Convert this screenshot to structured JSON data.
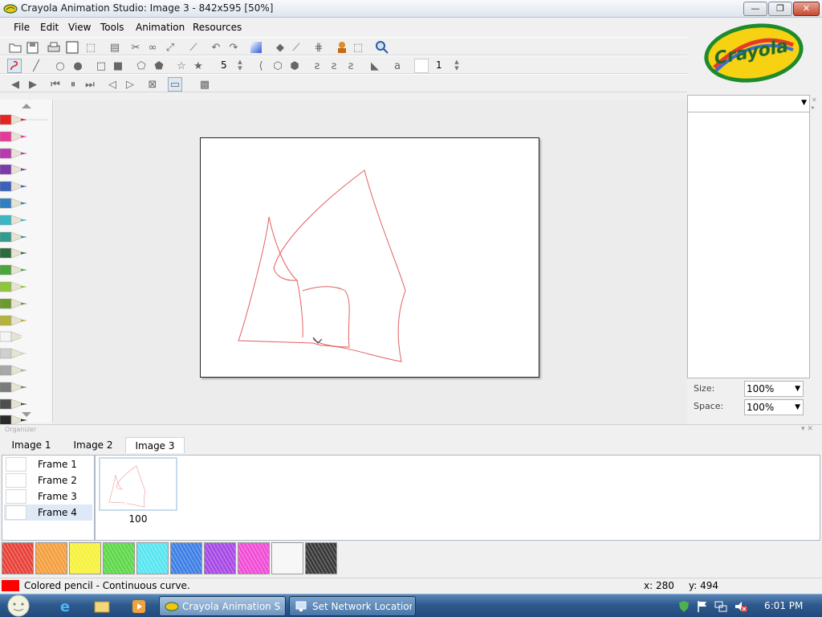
{
  "window": {
    "title": "Crayola Animation Studio: Image 3 - 842x595 [50%]",
    "minimize": "—",
    "maximize": "❐",
    "close": "✕"
  },
  "menu": [
    "File",
    "Edit",
    "View",
    "Tools",
    "Animation",
    "Resources"
  ],
  "toolbar": {
    "brush_size": "5",
    "line_width": "1"
  },
  "logo": {
    "text": "Crayola"
  },
  "pencil_colors": [
    "#e52521",
    "#e63a9a",
    "#b73ab0",
    "#7a3aa8",
    "#3b62b8",
    "#2f7fc1",
    "#38b7c5",
    "#2f9c8e",
    "#2b6b3c",
    "#4aa53a",
    "#8fc63a",
    "#6c9a2f",
    "#b6b33a",
    "#f4f4f4",
    "#cfcfcf",
    "#a8a8a8",
    "#7b7b7b",
    "#4e4e4e",
    "#2a2a2a"
  ],
  "right_panel": {
    "size_label": "Size:",
    "size_value": "100%",
    "space_label": "Space:",
    "space_value": "100%"
  },
  "organizer": {
    "label": "Organizer",
    "tabs": [
      "Image 1",
      "Image 2",
      "Image 3"
    ],
    "active_tab": "Image 3",
    "frames": [
      "Frame 1",
      "Frame 2",
      "Frame 3",
      "Frame 4"
    ],
    "selected_frame": "Frame 4",
    "thumb_label": "100"
  },
  "swatch_colors": [
    "#e8433a",
    "#f5a040",
    "#f6f23c",
    "#5ed84a",
    "#58e6f2",
    "#3f80e6",
    "#a74ae6",
    "#f04ed6",
    "#f6f6f6",
    "#3a3a3a"
  ],
  "status": {
    "color": "#ff0000",
    "text": "Colored pencil - Continuous curve.",
    "x": "x: 280",
    "y": "y: 494"
  },
  "taskbar": {
    "tasks": [
      "Crayola Animation S...",
      "Set Network Location"
    ],
    "clock": "6:01 PM"
  }
}
